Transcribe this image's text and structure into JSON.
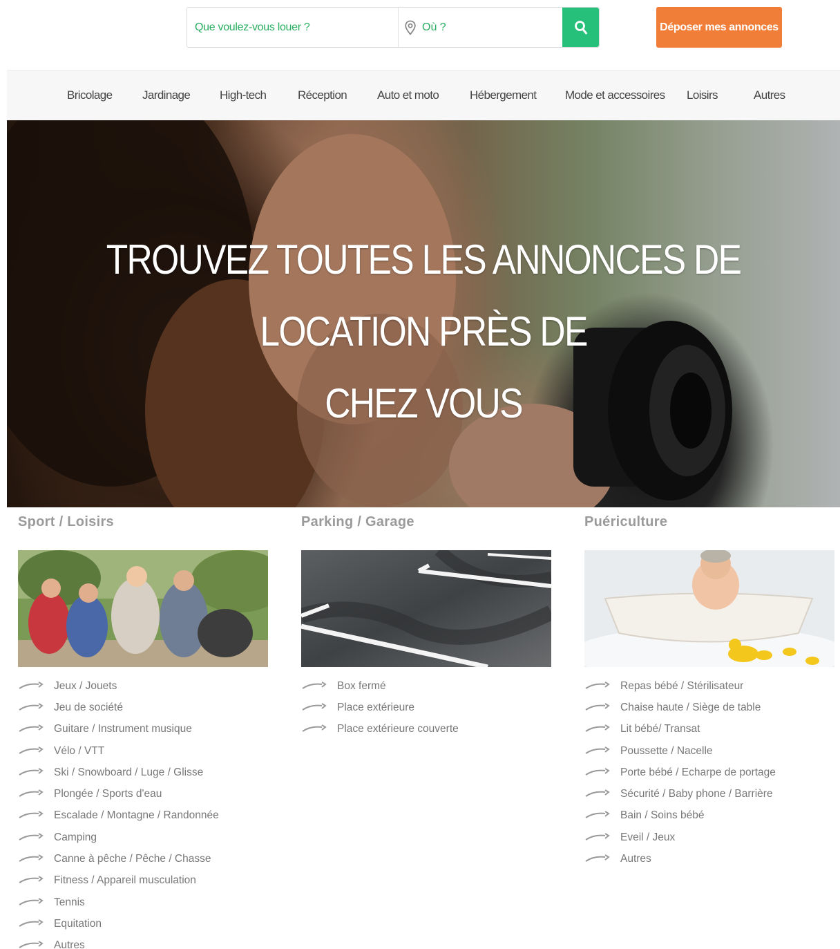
{
  "search": {
    "what_placeholder": "Que voulez-vous louer ?",
    "where_placeholder": "Où ?",
    "search_icon": "search-icon",
    "location_icon": "map-pin-icon"
  },
  "post_button": "Déposer mes annonces",
  "colors": {
    "green": "#27c07a",
    "orange": "#f07e38"
  },
  "nav": {
    "items": [
      "Bricolage",
      "Jardinage",
      "High-tech",
      "Réception",
      "Auto et moto",
      "Hébergement",
      "Mode et accessoires",
      "Loisirs",
      "Autres"
    ]
  },
  "hero": {
    "title_line1": "TROUVEZ TOUTES LES ANNONCES DE LOCATION PRÈS DE",
    "title_line2": "CHEZ VOUS"
  },
  "categories": [
    {
      "title": "Sport / Loisirs",
      "items": [
        "Jeux / Jouets",
        "Jeu de société",
        "Guitare / Instrument musique",
        "Vélo / VTT",
        "Ski / Snowboard / Luge / Glisse",
        "Plongée / Sports d'eau",
        "Escalade / Montagne / Randonnée",
        "Camping",
        "Canne à pêche / Pêche / Chasse",
        "Fitness / Appareil musculation",
        "Tennis",
        "Equitation",
        "Autres"
      ]
    },
    {
      "title": "Parking / Garage",
      "items": [
        "Box fermé",
        "Place extérieure",
        "Place extérieure couverte"
      ]
    },
    {
      "title": "Puériculture",
      "items": [
        "Repas bébé / Stérilisateur",
        "Chaise haute / Siège de table",
        "Lit bébé/ Transat",
        "Poussette / Nacelle",
        "Porte bébé / Echarpe de portage",
        "Sécurité / Baby phone / Barrière",
        "Bain / Soins bébé",
        "Eveil / Jeux",
        "Autres"
      ]
    }
  ]
}
